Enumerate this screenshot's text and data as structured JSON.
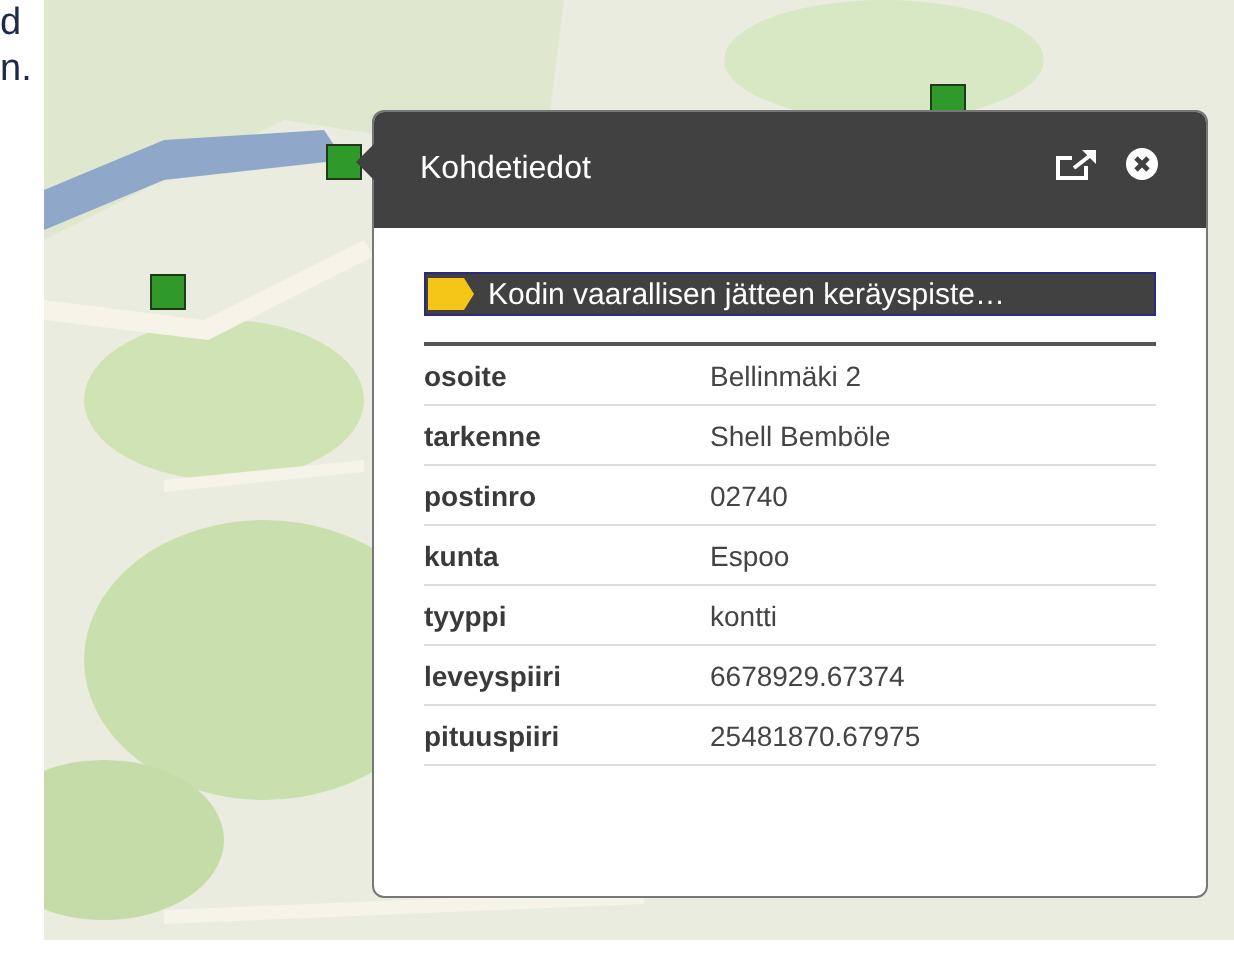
{
  "page_text": [
    "d",
    "n."
  ],
  "popup": {
    "title": "Kohdetiedot",
    "heading": "Kodin vaarallisen jätteen keräyspiste…",
    "fields": [
      {
        "label": "osoite",
        "value": "Bellinmäki 2"
      },
      {
        "label": "tarkenne",
        "value": "Shell Bemböle"
      },
      {
        "label": "postinro",
        "value": "02740"
      },
      {
        "label": "kunta",
        "value": "Espoo"
      },
      {
        "label": "tyyppi",
        "value": "kontti"
      },
      {
        "label": "leveyspiiri",
        "value": "6678929.67374"
      },
      {
        "label": "pituuspiiri",
        "value": "25481870.67975"
      }
    ]
  }
}
